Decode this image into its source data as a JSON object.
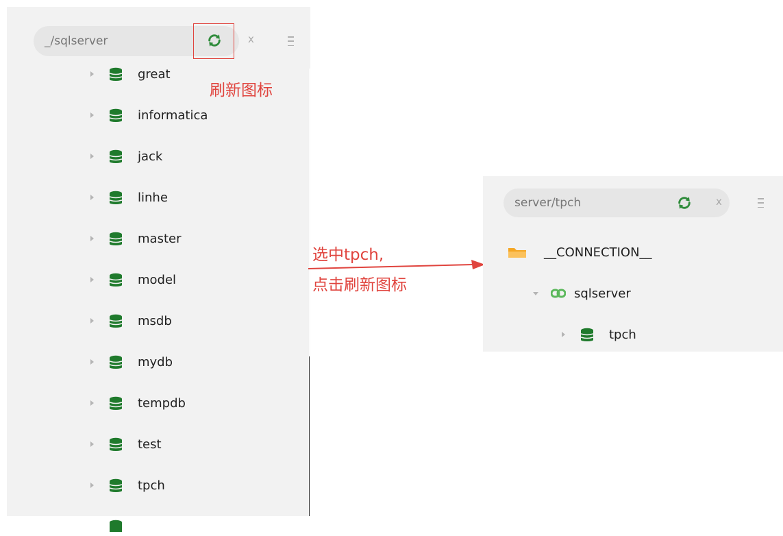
{
  "left_panel": {
    "search_value": "_/sqlserver",
    "close_label": "x",
    "databases": [
      {
        "label": "great"
      },
      {
        "label": "informatica"
      },
      {
        "label": "jack"
      },
      {
        "label": "linhe"
      },
      {
        "label": "master"
      },
      {
        "label": "model"
      },
      {
        "label": "msdb"
      },
      {
        "label": "mydb"
      },
      {
        "label": "tempdb"
      },
      {
        "label": "test"
      },
      {
        "label": "tpch"
      }
    ]
  },
  "right_panel": {
    "search_value": "server/tpch",
    "close_label": "x",
    "tree": {
      "connection_label": "__CONNECTION__",
      "server_label": "sqlserver",
      "database_label": "tpch"
    }
  },
  "annotations": {
    "refresh_note": "刷新图标",
    "step_line1": "选中tpch,",
    "step_line2": "点击刷新图标"
  },
  "colors": {
    "accent_green": "#2e8b3a",
    "annotation_red": "#e0443e",
    "folder_orange": "#f5a623"
  }
}
